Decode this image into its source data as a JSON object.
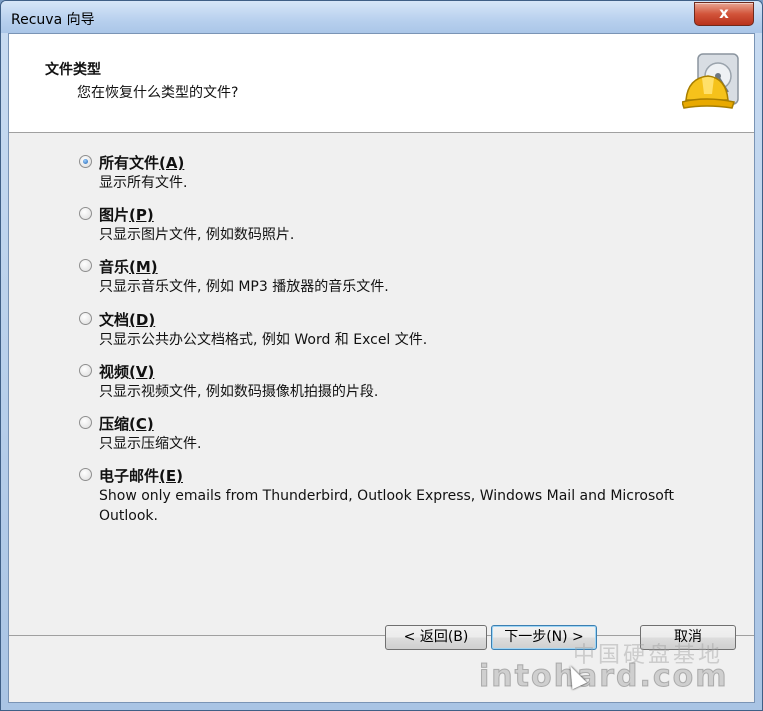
{
  "window": {
    "title": "Recuva 向导",
    "close_glyph": "x"
  },
  "header": {
    "title": "文件类型",
    "subtitle": "您在恢复什么类型的文件?",
    "logo_icon": "recuva-logo-icon"
  },
  "options": [
    {
      "label": "所有文件",
      "hotkey": "(A)",
      "desc": "显示所有文件.",
      "checked": true
    },
    {
      "label": "图片",
      "hotkey": "(P)",
      "desc": "只显示图片文件, 例如数码照片.",
      "checked": false
    },
    {
      "label": "音乐",
      "hotkey": "(M)",
      "desc": "只显示音乐文件, 例如 MP3 播放器的音乐文件.",
      "checked": false
    },
    {
      "label": "文档",
      "hotkey": "(D)",
      "desc": "只显示公共办公文档格式, 例如 Word 和 Excel 文件.",
      "checked": false
    },
    {
      "label": "视频",
      "hotkey": "(V)",
      "desc": "只显示视频文件, 例如数码摄像机拍摄的片段.",
      "checked": false
    },
    {
      "label": "压缩",
      "hotkey": "(C)",
      "desc": "只显示压缩文件.",
      "checked": false
    },
    {
      "label": "电子邮件",
      "hotkey": "(E)",
      "desc": "Show only emails from Thunderbird, Outlook Express, Windows Mail and Microsoft Outlook.",
      "checked": false
    }
  ],
  "buttons": {
    "back": "< 返回(B)",
    "next": "下一步(N) >",
    "cancel": "取消"
  },
  "watermark": {
    "text": "intohard.com",
    "text_cn": "中国硬盘基地"
  }
}
